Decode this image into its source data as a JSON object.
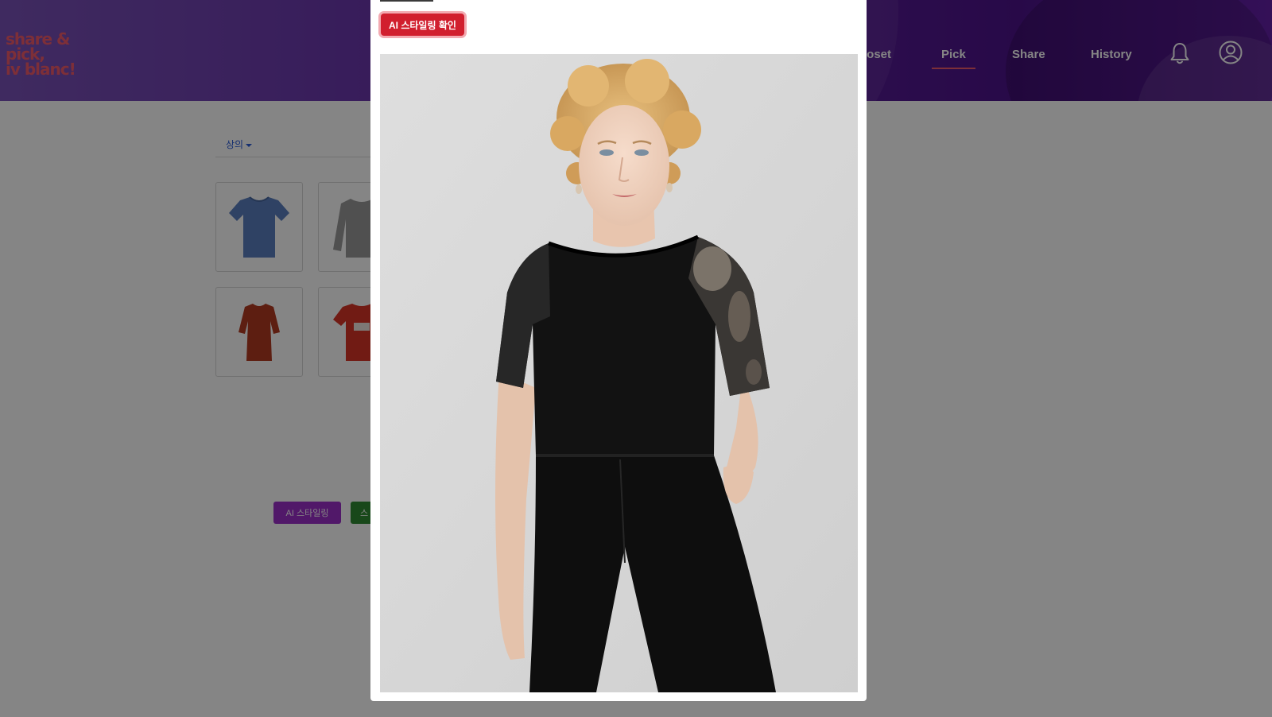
{
  "brand": {
    "logo_lines": [
      "share &",
      "pick,",
      "iv blanc!"
    ],
    "logo_color": "#f05a6b"
  },
  "header": {
    "nav": [
      "loset",
      "Pick",
      "Share",
      "History"
    ],
    "active_nav": "Pick",
    "icons": [
      "bell-icon",
      "user-icon"
    ],
    "gradient_colors": [
      "#7a52b8",
      "#5a1f9a",
      "#4d138b"
    ]
  },
  "page": {
    "category_label": "상의",
    "items": [
      {
        "name": "blue t-shirt",
        "color": "#5b7fc0"
      },
      {
        "name": "gray sweatshirt",
        "color": "#9a9a9a"
      },
      {
        "name": "rust red top",
        "color": "#b33a22"
      },
      {
        "name": "red graphic t-shirt",
        "color": "#d83528"
      }
    ],
    "ai_styling_button": "AI 스타일링",
    "second_button": "스"
  },
  "modal": {
    "confirm_button": "AI 스타일링 확인",
    "image_desc_icon": "model-photo"
  },
  "colors": {
    "confirm_button": "#d11f2e",
    "ai_button": "#9b2fc9",
    "green_button": "#2f8a32"
  }
}
